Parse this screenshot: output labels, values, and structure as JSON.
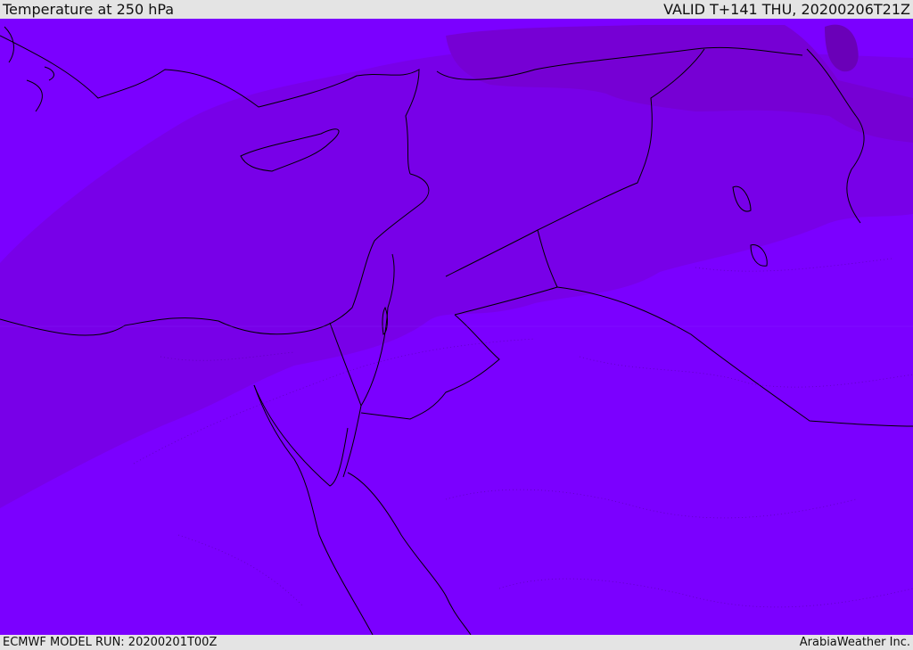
{
  "header": {
    "title": "Temperature at 250 hPa",
    "valid_time": "VALID T+141 THU, 20200206T21Z"
  },
  "footer": {
    "model_run": "ECMWF MODEL RUN: 20200201T00Z",
    "credit": "ArabiaWeather Inc."
  },
  "map": {
    "colors": {
      "coldest": "#7400cc",
      "very_cold": "#7900dd",
      "cold": "#7800e8",
      "base": "#7b00ff",
      "coast": "#000000",
      "border": "#000000"
    }
  }
}
